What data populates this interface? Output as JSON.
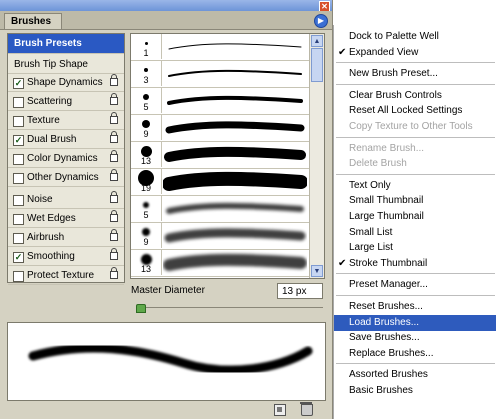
{
  "palette": {
    "tab_label": "Brushes",
    "close_glyph": "✕",
    "flyout_glyph": "▶",
    "options": [
      {
        "label": "Brush Presets",
        "kind": "header",
        "selected": true
      },
      {
        "label": "Brush Tip Shape",
        "kind": "plain"
      },
      {
        "label": "Shape Dynamics",
        "kind": "check",
        "checked": true,
        "locked": true
      },
      {
        "label": "Scattering",
        "kind": "check",
        "checked": false,
        "locked": true
      },
      {
        "label": "Texture",
        "kind": "check",
        "checked": false,
        "locked": true
      },
      {
        "label": "Dual Brush",
        "kind": "check",
        "checked": true,
        "locked": true
      },
      {
        "label": "Color Dynamics",
        "kind": "check",
        "checked": false,
        "locked": true
      },
      {
        "label": "Other Dynamics",
        "kind": "check",
        "checked": false,
        "locked": true
      },
      {
        "label": "Noise",
        "kind": "check",
        "checked": false,
        "locked": true
      },
      {
        "label": "Wet Edges",
        "kind": "check",
        "checked": false,
        "locked": true
      },
      {
        "label": "Airbrush",
        "kind": "check",
        "checked": false,
        "locked": true
      },
      {
        "label": "Smoothing",
        "kind": "check",
        "checked": true,
        "locked": true
      },
      {
        "label": "Protect Texture",
        "kind": "check",
        "checked": false,
        "locked": true
      }
    ],
    "presets": [
      {
        "size": "1",
        "style": "hard"
      },
      {
        "size": "3",
        "style": "hard"
      },
      {
        "size": "5",
        "style": "hard"
      },
      {
        "size": "9",
        "style": "hard"
      },
      {
        "size": "13",
        "style": "hard"
      },
      {
        "size": "19",
        "style": "hard"
      },
      {
        "size": "5",
        "style": "soft"
      },
      {
        "size": "9",
        "style": "soft"
      },
      {
        "size": "13",
        "style": "soft"
      }
    ],
    "scroll_up": "▲",
    "scroll_down": "▼",
    "master_diameter_label": "Master Diameter",
    "master_diameter_value": "13 px"
  },
  "menu": {
    "items": [
      {
        "label": "Dock to Palette Well"
      },
      {
        "label": "Expanded View",
        "checked": true
      },
      {
        "sep": true
      },
      {
        "label": "New Brush Preset..."
      },
      {
        "sep": true
      },
      {
        "label": "Clear Brush Controls"
      },
      {
        "label": "Reset All Locked Settings"
      },
      {
        "label": "Copy Texture to Other Tools",
        "disabled": true
      },
      {
        "sep": true
      },
      {
        "label": "Rename Brush...",
        "disabled": true
      },
      {
        "label": "Delete Brush",
        "disabled": true
      },
      {
        "sep": true
      },
      {
        "label": "Text Only"
      },
      {
        "label": "Small Thumbnail"
      },
      {
        "label": "Large Thumbnail"
      },
      {
        "label": "Small List"
      },
      {
        "label": "Large List"
      },
      {
        "label": "Stroke Thumbnail",
        "checked": true
      },
      {
        "sep": true
      },
      {
        "label": "Preset Manager..."
      },
      {
        "sep": true
      },
      {
        "label": "Reset Brushes..."
      },
      {
        "label": "Load Brushes...",
        "highlighted": true
      },
      {
        "label": "Save Brushes..."
      },
      {
        "label": "Replace Brushes..."
      },
      {
        "sep": true
      },
      {
        "label": "Assorted Brushes"
      },
      {
        "label": "Basic Brushes"
      }
    ]
  }
}
